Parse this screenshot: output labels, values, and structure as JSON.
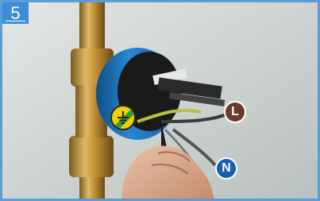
{
  "step": {
    "number": "5"
  },
  "labels": {
    "live": "L",
    "neutral": "N"
  },
  "icons": {
    "earth": "earth-ground-icon"
  },
  "colors": {
    "frame_border": "#5a9cd6",
    "badge_bg": "#3a8dd6",
    "live_circle": "#6b3a2a",
    "neutral_circle": "#1560b0",
    "earth_yellow": "#f0d000",
    "earth_green": "#2f9a3a"
  }
}
